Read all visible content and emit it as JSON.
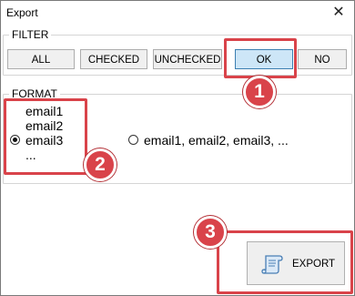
{
  "window": {
    "title": "Export",
    "close_glyph": "✕"
  },
  "filter": {
    "label": "FILTER",
    "buttons": [
      "ALL",
      "CHECKED",
      "UNCHECKED",
      "OK",
      "NO"
    ],
    "selected": "OK"
  },
  "format": {
    "label": "FORMAT",
    "option1": {
      "lines": [
        "email1",
        "email2",
        "email3",
        "..."
      ],
      "selected": true
    },
    "option2": {
      "text": "email1, email2, email3, ...",
      "selected": false
    }
  },
  "export": {
    "label": "EXPORT",
    "icon": "scroll-icon"
  },
  "annotations": {
    "color": "#d9434a",
    "badges": [
      "1",
      "2",
      "3"
    ]
  }
}
